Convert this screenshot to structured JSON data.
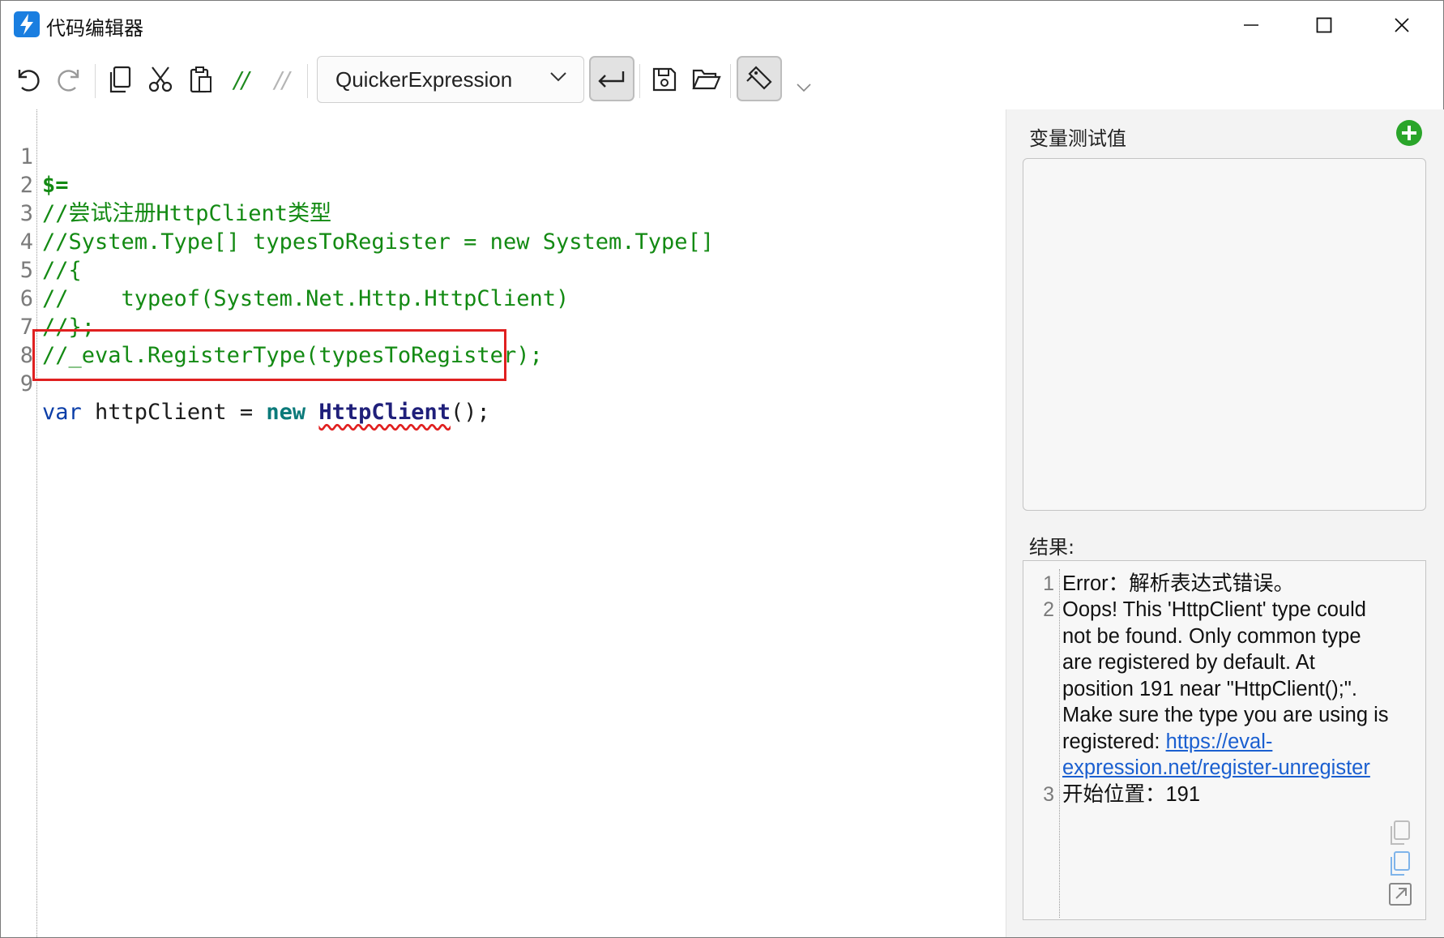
{
  "window": {
    "title": "代码编辑器",
    "controls": [
      "minimize",
      "maximize",
      "close"
    ]
  },
  "toolbar": {
    "items": [
      "undo-icon",
      "redo-icon",
      "copy-icon",
      "cut-icon",
      "paste-icon",
      "comment-icon",
      "uncomment-icon"
    ],
    "comment_label": "//",
    "uncomment_label": "//",
    "language": "QuickerExpression"
  },
  "editor": {
    "lines": [
      {
        "num": "1",
        "text": "$="
      },
      {
        "num": "2",
        "text": "//尝试注册HttpClient类型"
      },
      {
        "num": "3",
        "text": "//System.Type[] typesToRegister = new System.Type[]"
      },
      {
        "num": "4",
        "text": "//{"
      },
      {
        "num": "5",
        "text": "//    typeof(System.Net.Http.HttpClient)"
      },
      {
        "num": "6",
        "text": "//};"
      },
      {
        "num": "7",
        "text": "//_eval.RegisterType(typesToRegister);"
      },
      {
        "num": "8",
        "text": ""
      },
      {
        "num": "9",
        "kw": "var",
        "ident": " httpClient = ",
        "kw_new": "new",
        "type": "HttpClient",
        "rest": "();"
      }
    ]
  },
  "side": {
    "var_title": "变量测试值",
    "result_label": "结果:",
    "result_lines": [
      {
        "num": "1",
        "text": "Error：解析表达式错误。"
      },
      {
        "num": "2",
        "text": "Oops! This 'HttpClient' type could",
        "cont": [
          "not be found. Only common type",
          "are registered by default. At",
          "position 191 near \"HttpClient();\".",
          "Make sure the type you are using is"
        ],
        "pre_link": "registered: ",
        "link1": "https://eval-",
        "link2": "expression.net/register-unregister"
      },
      {
        "num": "3",
        "text": "开始位置：191"
      }
    ]
  },
  "colors": {
    "comment": "#138a13",
    "keyword": "#0b3ea8",
    "highlight": "#e02020",
    "link": "#1a5fd0",
    "add": "#2aa52a"
  }
}
